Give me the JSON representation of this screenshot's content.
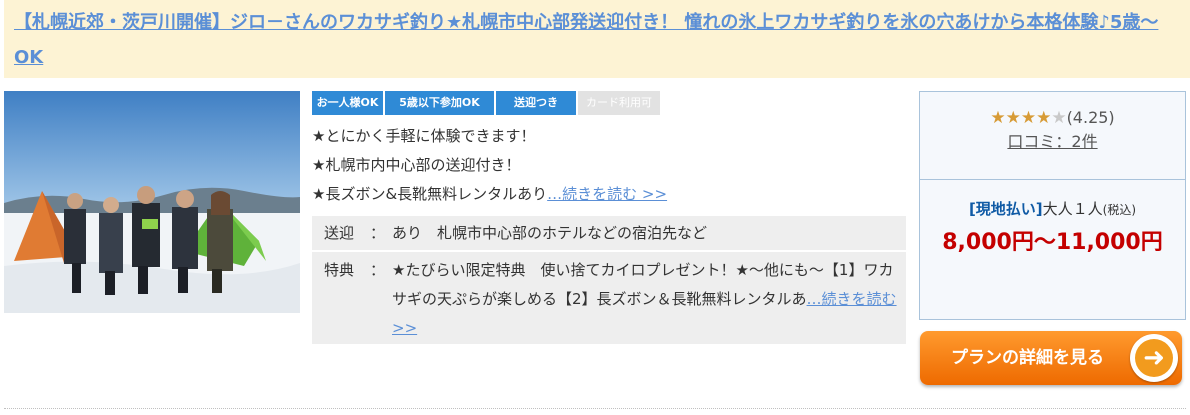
{
  "title": "【札幌近郊・茨戸川開催】ジロ－さんのワカサギ釣り★札幌市中心部発送迎付き！ 憧れの氷上ワカサギ釣りを氷の穴あけから本格体験♪5歳〜OK",
  "badges": [
    "お一人様OK",
    "5歳以下参加OK",
    "送迎つき",
    "カード利用可"
  ],
  "features": [
    "★とにかく手軽に体験できます！",
    "★札幌市内中心部の送迎付き！",
    "★長ズボン&長靴無料レンタルあり"
  ],
  "more_link": "…続きを読む >>",
  "info": {
    "pickup_label": "送迎",
    "colon": "：",
    "pickup_value": "あり　札幌市中心部のホテルなどの宿泊先など",
    "perks_label": "特典",
    "perks_value": "★たびらい限定特典　使い捨てカイロプレゼント！★〜他にも〜【1】ワカサギの天ぷらが楽しめる【2】長ズボン＆長靴無料レンタルあ",
    "more_link": "…続きを読む >>"
  },
  "rating": {
    "score_text": "(4.25)",
    "stars_filled": 4,
    "stars_total": 5,
    "reviews_label": "口コミ：2件"
  },
  "price": {
    "payment_type": "[現地払い]",
    "per_person": "大人１人",
    "tax_note": "(税込)",
    "amount": "8,000円〜11,000円"
  },
  "cta_label": "プランの詳細を見る",
  "colors": {
    "title_bg": "#fdf3d4",
    "link": "#5b8fd6",
    "badge_active": "#2f8ad6",
    "badge_inactive": "#e2e2e2",
    "price": "#c40000",
    "cta": "#f08c1e"
  }
}
